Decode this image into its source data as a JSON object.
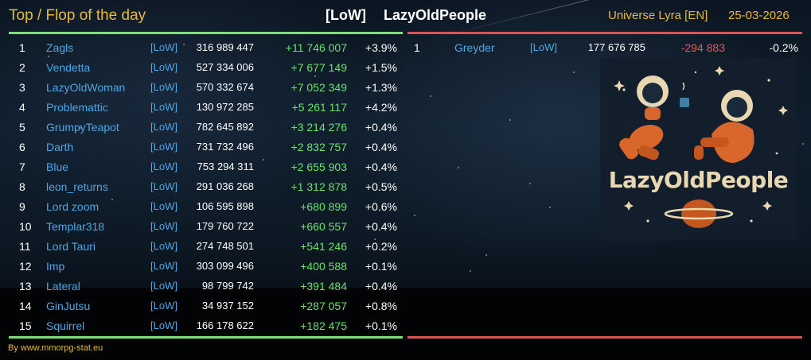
{
  "header": {
    "title": "Top / Flop of the day",
    "alliance_tag": "[LoW]",
    "alliance_name": "LazyOldPeople",
    "universe": "Universe Lyra [EN]",
    "date": "25-03-2026"
  },
  "top": [
    {
      "rank": "1",
      "name": "Zagls",
      "tag": "[LoW]",
      "points": "316 989 447",
      "diff": "+11 746 007",
      "pct": "+3.9%"
    },
    {
      "rank": "2",
      "name": "Vendetta",
      "tag": "[LoW]",
      "points": "527 334 006",
      "diff": "+7 677 149",
      "pct": "+1.5%"
    },
    {
      "rank": "3",
      "name": "LazyOldWoman",
      "tag": "[LoW]",
      "points": "570 332 674",
      "diff": "+7 052 349",
      "pct": "+1.3%"
    },
    {
      "rank": "4",
      "name": "Problemattic",
      "tag": "[LoW]",
      "points": "130 972 285",
      "diff": "+5 261 117",
      "pct": "+4.2%"
    },
    {
      "rank": "5",
      "name": "GrumpyTeapot",
      "tag": "[LoW]",
      "points": "782 645 892",
      "diff": "+3 214 276",
      "pct": "+0.4%"
    },
    {
      "rank": "6",
      "name": "Darth",
      "tag": "[LoW]",
      "points": "731 732 496",
      "diff": "+2 832 757",
      "pct": "+0.4%"
    },
    {
      "rank": "7",
      "name": "Blue",
      "tag": "[LoW]",
      "points": "753 294 311",
      "diff": "+2 655 903",
      "pct": "+0.4%"
    },
    {
      "rank": "8",
      "name": "leon_returns",
      "tag": "[LoW]",
      "points": "291 036 268",
      "diff": "+1 312 878",
      "pct": "+0.5%"
    },
    {
      "rank": "9",
      "name": "Lord zoom",
      "tag": "[LoW]",
      "points": "106 595 898",
      "diff": "+680 899",
      "pct": "+0.6%"
    },
    {
      "rank": "10",
      "name": "Templar318",
      "tag": "[LoW]",
      "points": "179 760 722",
      "diff": "+660 557",
      "pct": "+0.4%"
    },
    {
      "rank": "11",
      "name": "Lord Tauri",
      "tag": "[LoW]",
      "points": "274 748 501",
      "diff": "+541 246",
      "pct": "+0.2%"
    },
    {
      "rank": "12",
      "name": "Imp",
      "tag": "[LoW]",
      "points": "303 099 496",
      "diff": "+400 588",
      "pct": "+0.1%"
    },
    {
      "rank": "13",
      "name": "Lateral",
      "tag": "[LoW]",
      "points": "98 799 742",
      "diff": "+391 484",
      "pct": "+0.4%"
    },
    {
      "rank": "14",
      "name": "GinJutsu",
      "tag": "[LoW]",
      "points": "34 937 152",
      "diff": "+287 057",
      "pct": "+0.8%"
    },
    {
      "rank": "15",
      "name": "Squirrel",
      "tag": "[LoW]",
      "points": "166 178 622",
      "diff": "+182 475",
      "pct": "+0.1%"
    }
  ],
  "flop": [
    {
      "rank": "1",
      "name": "Greyder",
      "tag": "[LoW]",
      "points": "177 676 785",
      "diff": "-294 883",
      "pct": "-0.2%"
    }
  ],
  "logo": {
    "text": "LazyOldPeople",
    "icon": "astronauts-relaxing-logo-icon"
  },
  "footer": {
    "credit": "By www.mmorpg-stat.eu"
  },
  "colors": {
    "accent": "#e8b93a",
    "name": "#4fa7e6",
    "positive": "#6be36b",
    "negative": "#ef5454",
    "top_rule": "#7ee07a",
    "flop_rule": "#d95454"
  }
}
